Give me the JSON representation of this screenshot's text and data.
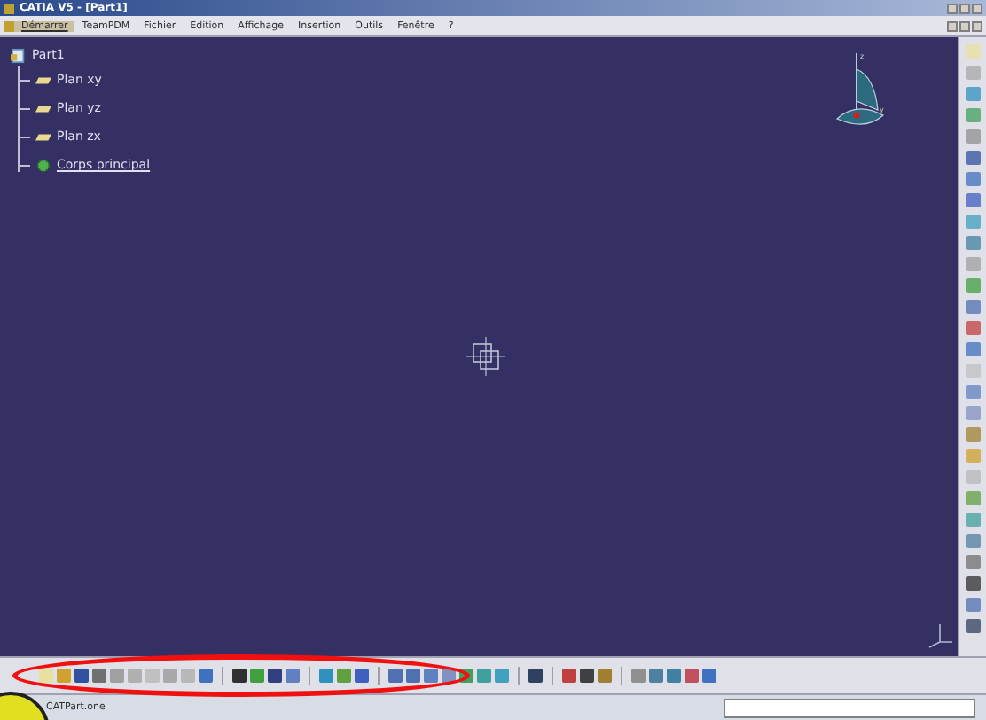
{
  "window": {
    "title": "CATIA V5 - [Part1]"
  },
  "menu": [
    {
      "label": "Démarrer",
      "selected": true
    },
    {
      "label": "TeamPDM",
      "selected": false
    },
    {
      "label": "Fichier",
      "selected": false
    },
    {
      "label": "Edition",
      "selected": false
    },
    {
      "label": "Affichage",
      "selected": false
    },
    {
      "label": "Insertion",
      "selected": false
    },
    {
      "label": "Outils",
      "selected": false
    },
    {
      "label": "Fenêtre",
      "selected": false
    },
    {
      "label": "?",
      "selected": false
    }
  ],
  "tree": {
    "label": "Part1",
    "children": [
      {
        "label": "Plan xy",
        "kind": "plane"
      },
      {
        "label": "Plan yz",
        "kind": "plane"
      },
      {
        "label": "Plan zx",
        "kind": "plane"
      },
      {
        "label": "Corps principal",
        "kind": "body"
      }
    ]
  },
  "compass": {
    "z_label": "z",
    "y_label": "y"
  },
  "status_bar": {
    "text": "CATPart.one"
  }
}
